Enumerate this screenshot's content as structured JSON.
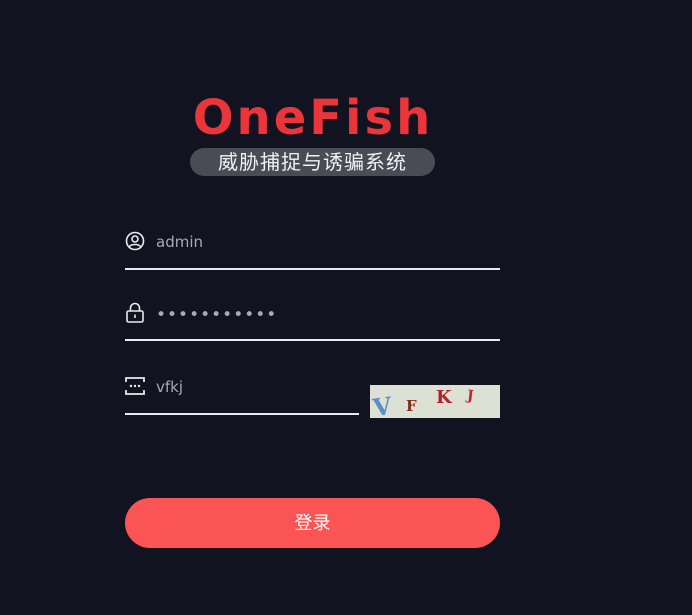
{
  "brand": {
    "title": "OneFish",
    "subtitle": "威胁捕捉与诱骗系统",
    "title_color": "#e8363b"
  },
  "form": {
    "username": {
      "value": "admin",
      "icon": "user-circle-icon"
    },
    "password": {
      "value": "•••••••••••",
      "icon": "lock-icon"
    },
    "captcha_input": {
      "value": "vfkj",
      "icon": "captcha-icon"
    },
    "captcha_image": {
      "chars": [
        "V",
        "F",
        "K",
        "J"
      ],
      "colors": [
        "#5a8fc7",
        "#8a2a1a",
        "#b3222f",
        "#c0262f"
      ]
    },
    "login_label": "登录",
    "login_color": "#fb5454"
  }
}
